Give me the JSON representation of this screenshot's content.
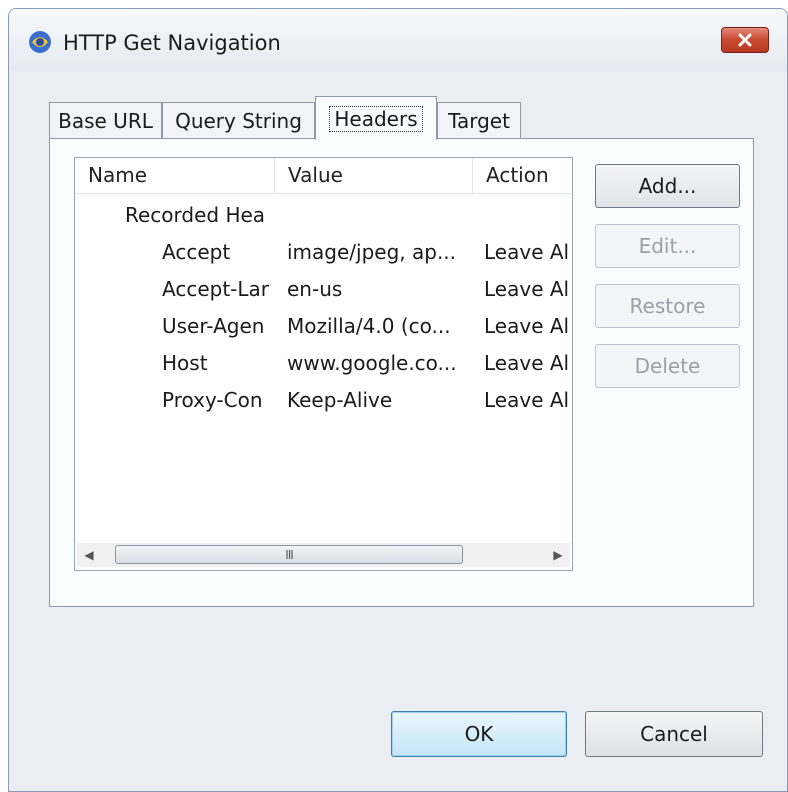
{
  "window": {
    "title": "HTTP Get Navigation",
    "icon": "app-icon",
    "close_icon": "close-icon"
  },
  "tabs": [
    {
      "label": "Base URL",
      "active": false
    },
    {
      "label": "Query String",
      "active": false
    },
    {
      "label": "Headers",
      "active": true
    },
    {
      "label": "Target",
      "active": false
    }
  ],
  "headers_list": {
    "columns": [
      "Name",
      "Value",
      "Action"
    ],
    "group_label": "Recorded Hea",
    "rows": [
      {
        "name": "Accept",
        "value": "image/jpeg, ap...",
        "action": "Leave Al"
      },
      {
        "name": "Accept-Lar",
        "value": "en-us",
        "action": "Leave Al"
      },
      {
        "name": "User-Agen",
        "value": "Mozilla/4.0 (co...",
        "action": "Leave Al"
      },
      {
        "name": "Host",
        "value": "www.google.co...",
        "action": "Leave Al"
      },
      {
        "name": "Proxy-Con",
        "value": "Keep-Alive",
        "action": "Leave Al"
      }
    ],
    "scroll_thumb_grip": "III"
  },
  "side_buttons": {
    "add": "Add...",
    "edit": "Edit...",
    "restore": "Restore",
    "delete": "Delete"
  },
  "footer": {
    "ok": "OK",
    "cancel": "Cancel"
  },
  "colors": {
    "dialog_bg": "#eaeef2",
    "close_button": "#c74a31",
    "default_button_border": "#3c7fb1",
    "disabled_text": "#9aa0a6"
  }
}
